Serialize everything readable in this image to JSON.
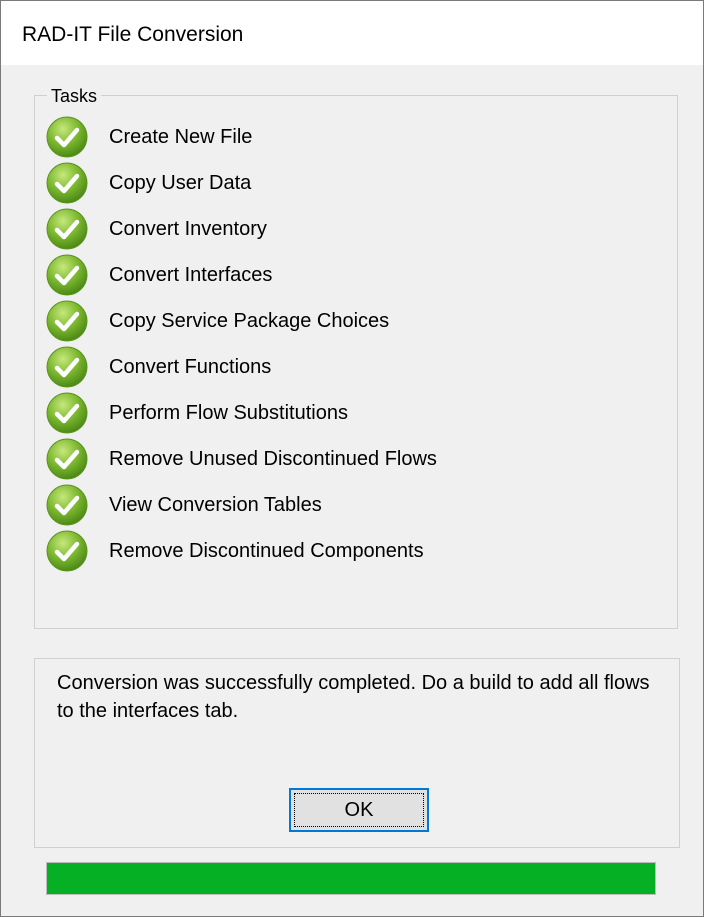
{
  "window": {
    "title": "RAD-IT File Conversion"
  },
  "tasks": {
    "group_label": "Tasks",
    "items": [
      {
        "label": "Create New File",
        "status": "completed",
        "icon": "green-check-icon"
      },
      {
        "label": "Copy User Data",
        "status": "completed",
        "icon": "green-check-icon"
      },
      {
        "label": "Convert Inventory",
        "status": "completed",
        "icon": "green-check-icon"
      },
      {
        "label": "Convert Interfaces",
        "status": "completed",
        "icon": "green-check-icon"
      },
      {
        "label": "Copy Service Package Choices",
        "status": "completed",
        "icon": "green-check-icon"
      },
      {
        "label": "Convert Functions",
        "status": "completed",
        "icon": "green-check-icon"
      },
      {
        "label": "Perform Flow Substitutions",
        "status": "completed",
        "icon": "green-check-icon"
      },
      {
        "label": "Remove Unused Discontinued Flows",
        "status": "completed",
        "icon": "green-check-icon"
      },
      {
        "label": "View Conversion Tables",
        "status": "completed",
        "icon": "green-check-icon"
      },
      {
        "label": "Remove Discontinued Components",
        "status": "completed",
        "icon": "green-check-icon"
      }
    ]
  },
  "message": {
    "text": "Conversion was successfully completed. Do a build to add all flows to the interfaces tab."
  },
  "buttons": {
    "ok_label": "OK"
  },
  "progress": {
    "percent": 100
  },
  "colors": {
    "check_green": "#7cb82f",
    "progress_green": "#06b025",
    "focus_blue": "#0078d7"
  }
}
